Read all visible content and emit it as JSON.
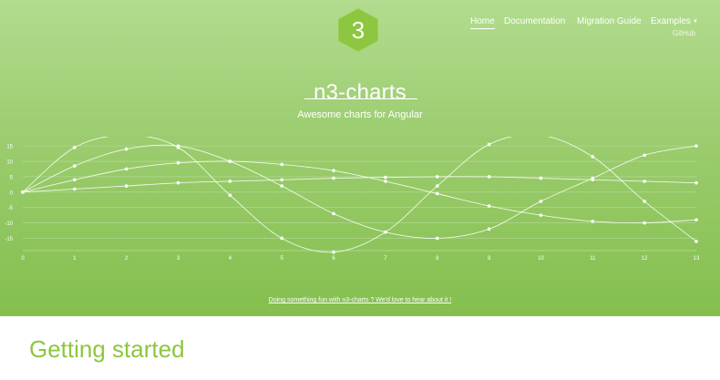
{
  "logo": {
    "glyph": "3",
    "color": "#8dc63f"
  },
  "nav": {
    "items": [
      {
        "label": "Home",
        "active": true
      },
      {
        "label": "Documentation",
        "active": false
      },
      {
        "label": "Migration Guide",
        "active": false
      },
      {
        "label": "Examples",
        "active": false
      }
    ],
    "dropdown_label": "GitHub"
  },
  "hero": {
    "title": "n3-charts",
    "subtitle": "Awesome charts for Angular",
    "footer_link": "Doing something fun with n3-charts ? We'd love to hear about it !"
  },
  "section": {
    "heading": "Getting started"
  },
  "colors": {
    "accent": "#8dc63f",
    "line": "#ffffff"
  },
  "chart_data": {
    "type": "line",
    "x": [
      0,
      1,
      2,
      3,
      4,
      5,
      6,
      7,
      8,
      9,
      10,
      11,
      12,
      13
    ],
    "yticks": [
      15,
      10,
      5,
      0,
      -5,
      -10,
      -15
    ],
    "ylim": [
      -19,
      18
    ],
    "xlim": [
      0,
      13
    ],
    "grid": true,
    "series": [
      {
        "values": [
          0,
          14.5,
          18.5,
          14.5,
          -1,
          -15,
          -19.5,
          -13,
          2,
          15.5,
          18.5,
          11.5,
          -3,
          -16
        ]
      },
      {
        "values": [
          0,
          8.5,
          14,
          15,
          10,
          2,
          -7,
          -13,
          -15,
          -12,
          -3,
          4.5,
          12,
          15
        ]
      },
      {
        "values": [
          0,
          4,
          7.5,
          9.5,
          10,
          9,
          7,
          3.5,
          -0.5,
          -4.5,
          -7.5,
          -9.5,
          -10,
          -9
        ]
      },
      {
        "values": [
          0,
          1,
          2,
          3,
          3.5,
          4,
          4.5,
          4.8,
          5,
          5,
          4.5,
          4,
          3.5,
          3
        ]
      }
    ]
  }
}
